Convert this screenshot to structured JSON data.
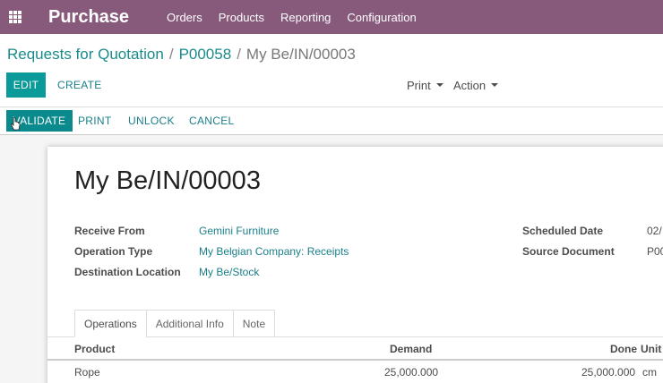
{
  "navbar": {
    "app_title": "Purchase",
    "menu": [
      "Orders",
      "Products",
      "Reporting",
      "Configuration"
    ]
  },
  "breadcrumb": {
    "items": [
      "Requests for Quotation",
      "P00058"
    ],
    "current": "My Be/IN/00003"
  },
  "control_panel": {
    "edit_label": "EDIT",
    "create_label": "CREATE",
    "print_label": "Print",
    "action_label": "Action"
  },
  "statusbar": {
    "validate_label": "VALIDATE",
    "print_label": "PRINT",
    "unlock_label": "UNLOCK",
    "cancel_label": "CANCEL"
  },
  "form": {
    "title": "My Be/IN/00003",
    "receive_from_label": "Receive From",
    "receive_from_value": "Gemini Furniture",
    "operation_type_label": "Operation Type",
    "operation_type_value": "My Belgian Company: Receipts",
    "destination_label": "Destination Location",
    "destination_value": "My Be/Stock",
    "scheduled_date_label": "Scheduled Date",
    "scheduled_date_value": "02/",
    "source_document_label": "Source Document",
    "source_document_value": "P00"
  },
  "tabs": [
    "Operations",
    "Additional Info",
    "Note"
  ],
  "table": {
    "headers": {
      "product": "Product",
      "demand": "Demand",
      "done": "Done",
      "unit": "Unit"
    },
    "rows": [
      {
        "product": "Rope",
        "demand": "25,000.000",
        "done": "25,000.000",
        "unit": "cm"
      }
    ]
  },
  "colors": {
    "navbar": "#875a7b",
    "primary": "#0b9a9a",
    "link": "#1a7f8a"
  }
}
